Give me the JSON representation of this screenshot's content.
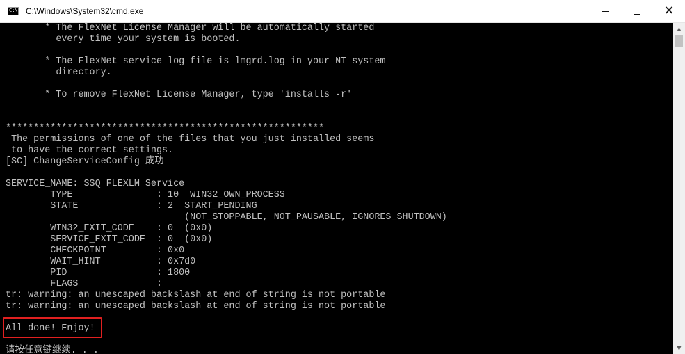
{
  "window": {
    "title": "C:\\Windows\\System32\\cmd.exe",
    "icon_name": "cmd-icon",
    "icon_text": "C:\\"
  },
  "controls": {
    "minimize_icon": "minimize-icon",
    "maximize_icon": "maximize-icon",
    "close_icon": "close-icon",
    "close_glyph": "✕"
  },
  "console": {
    "colors": {
      "background": "#000000",
      "text": "#c0c0c0",
      "highlight": "#e02020"
    },
    "lines": [
      "       * The FlexNet License Manager will be automatically started",
      "         every time your system is booted.",
      "",
      "       * The FlexNet service log file is lmgrd.log in your NT system",
      "         directory.",
      "",
      "       * To remove FlexNet License Manager, type 'installs -r'",
      "",
      "",
      "*********************************************************",
      " The permissions of one of the files that you just installed seems",
      " to have the correct settings.",
      "[SC] ChangeServiceConfig 成功",
      "",
      "SERVICE_NAME: SSQ FLEXLM Service",
      "        TYPE               : 10  WIN32_OWN_PROCESS",
      "        STATE              : 2  START_PENDING",
      "                                (NOT_STOPPABLE, NOT_PAUSABLE, IGNORES_SHUTDOWN)",
      "        WIN32_EXIT_CODE    : 0  (0x0)",
      "        SERVICE_EXIT_CODE  : 0  (0x0)",
      "        CHECKPOINT         : 0x0",
      "        WAIT_HINT          : 0x7d0",
      "        PID                : 1800",
      "        FLAGS              :",
      "tr: warning: an unescaped backslash at end of string is not portable",
      "tr: warning: an unescaped backslash at end of string is not portable",
      "",
      "All done! Enjoy!",
      "",
      "请按任意键继续. . ."
    ]
  },
  "scrollbar": {
    "up_glyph": "▲",
    "down_glyph": "▼"
  }
}
